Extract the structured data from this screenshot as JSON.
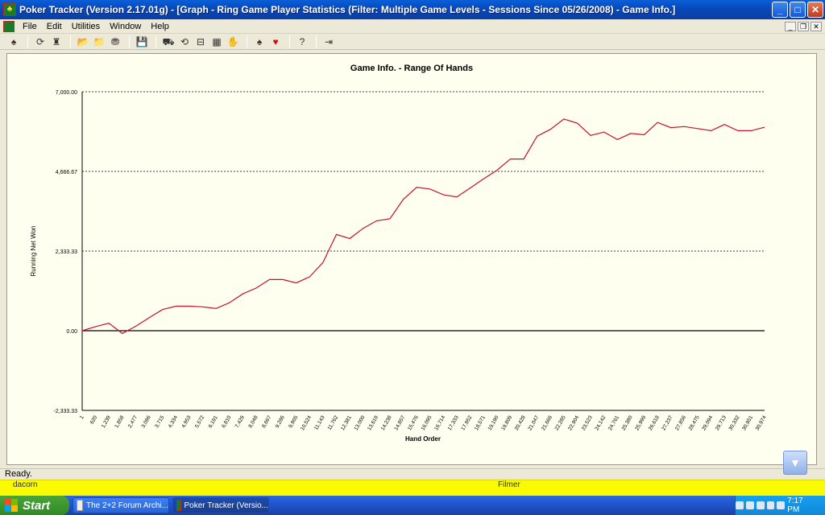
{
  "window": {
    "title": "Poker Tracker (Version 2.17.01g) - [Graph - Ring Game Player Statistics (Filter: Multiple Game Levels - Sessions Since 05/26/2008) - Game Info.]",
    "minimize": "_",
    "maximize": "□",
    "close": "✕"
  },
  "menu": {
    "items": [
      "File",
      "Edit",
      "Utilities",
      "Window",
      "Help"
    ],
    "mdi_min": "_",
    "mdi_restore": "❐",
    "mdi_close": "✕"
  },
  "toolbar": {
    "icons": [
      "arrows-icon",
      "refresh-icon",
      "trophy-icon",
      "open-folder-icon",
      "folder-icon",
      "database-icon",
      "save-icon",
      "car-icon",
      "sync-icon",
      "export-icon",
      "grid-icon",
      "hand-icon",
      "spade-icon",
      "heart-icon",
      "help-icon",
      "exit-icon"
    ],
    "glyphs": [
      "♠",
      "⟳",
      "♜",
      "📂",
      "📁",
      "⛃",
      "💾",
      "⛟",
      "⟲",
      "⊟",
      "▦",
      "✋",
      "♠",
      "♥",
      "?",
      "⇥"
    ]
  },
  "chart_data": {
    "type": "line",
    "title": "Game Info. - Range Of Hands",
    "xlabel": "Hand Order",
    "ylabel": "Running Net Won",
    "ylim": [
      -2333.33,
      7000.0
    ],
    "yticks": [
      "7,000.00",
      "4,666.67",
      "2,333.33",
      "0.00",
      "-2,333.33"
    ],
    "ytick_values": [
      7000.0,
      4666.67,
      2333.33,
      0.0,
      -2333.33
    ],
    "grid": true,
    "x": [
      1,
      620,
      1239,
      1858,
      2477,
      3096,
      3715,
      4334,
      4953,
      5572,
      6191,
      6810,
      7429,
      8048,
      8667,
      9286,
      9905,
      10524,
      11143,
      11762,
      12381,
      13000,
      13619,
      14238,
      14857,
      15476,
      16095,
      16714,
      17333,
      17952,
      18571,
      19190,
      19809,
      20428,
      21047,
      21666,
      22285,
      22904,
      23523,
      24142,
      24761,
      25380,
      25999,
      26618,
      27237,
      27856,
      28475,
      29094,
      29713,
      30332,
      30951,
      30974
    ],
    "xtick_labels": [
      "1",
      "620",
      "1,239",
      "1,858",
      "2,477",
      "3,096",
      "3,715",
      "4,334",
      "4,953",
      "5,572",
      "6,191",
      "6,810",
      "7,429",
      "8,048",
      "8,667",
      "9,286",
      "9,905",
      "10,524",
      "11,143",
      "11,762",
      "12,381",
      "13,000",
      "13,619",
      "14,238",
      "14,857",
      "15,476",
      "16,095",
      "16,714",
      "17,333",
      "17,952",
      "18,571",
      "19,190",
      "19,809",
      "20,428",
      "21,047",
      "21,666",
      "22,285",
      "22,904",
      "23,523",
      "24,142",
      "24,761",
      "25,380",
      "25,999",
      "26,618",
      "27,237",
      "27,856",
      "28,475",
      "29,094",
      "29,713",
      "30,332",
      "30,951",
      "30,974"
    ],
    "series": [
      {
        "values": [
          0,
          120,
          220,
          -80,
          130,
          380,
          620,
          720,
          720,
          700,
          650,
          820,
          1080,
          1250,
          1500,
          1500,
          1400,
          1580,
          2000,
          2820,
          2700,
          3000,
          3220,
          3280,
          3850,
          4200,
          4150,
          3980,
          3920,
          4180,
          4450,
          4700,
          5030,
          5030,
          5700,
          5900,
          6200,
          6080,
          5720,
          5820,
          5600,
          5780,
          5740,
          6100,
          5950,
          5980,
          5920,
          5860,
          6040,
          5860,
          5860,
          5960
        ],
        "color": "#c8102e"
      }
    ]
  },
  "status": {
    "text": "Ready."
  },
  "bottom": {
    "left_name": "dacorn",
    "right_name": "Filmer"
  },
  "taskbar": {
    "start": "Start",
    "tasks": [
      "The 2+2 Forum Archi...",
      "Poker Tracker (Versio..."
    ],
    "clock": "7:17 PM"
  }
}
